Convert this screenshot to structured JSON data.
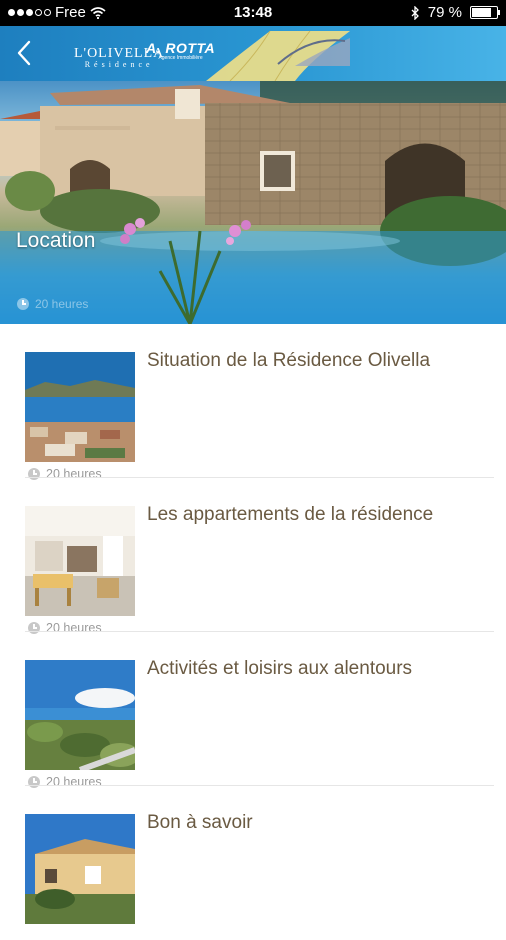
{
  "status_bar": {
    "carrier": "Free",
    "time": "13:48",
    "battery": "79 %",
    "battery_level": 0.79,
    "signal_icon": "signal-dots-icon",
    "wifi_icon": "wifi-icon",
    "bluetooth_icon": "bluetooth-icon"
  },
  "header": {
    "back_icon": "chevron-left-icon",
    "logo_olivella": {
      "line1": "L'OLIVELLA",
      "line2": "Résidence"
    },
    "logo_rotta": {
      "line1": "A. ROTTA",
      "line2": "Agence Immobilière"
    },
    "accent_color": "#2a97d3"
  },
  "hero": {
    "title": "Location",
    "meta": "20 heures"
  },
  "articles": [
    {
      "title": "Situation de la Résidence Olivella",
      "meta": "20 heures"
    },
    {
      "title": "Les appartements de la résidence",
      "meta": "20 heures"
    },
    {
      "title": "Activités et loisirs aux alentours",
      "meta": "20 heures"
    },
    {
      "title": "Bon à savoir",
      "meta": ""
    }
  ],
  "colors": {
    "title_text": "#6a5a42",
    "meta_text": "#9b9b9b",
    "separator": "#e6e6e6"
  }
}
